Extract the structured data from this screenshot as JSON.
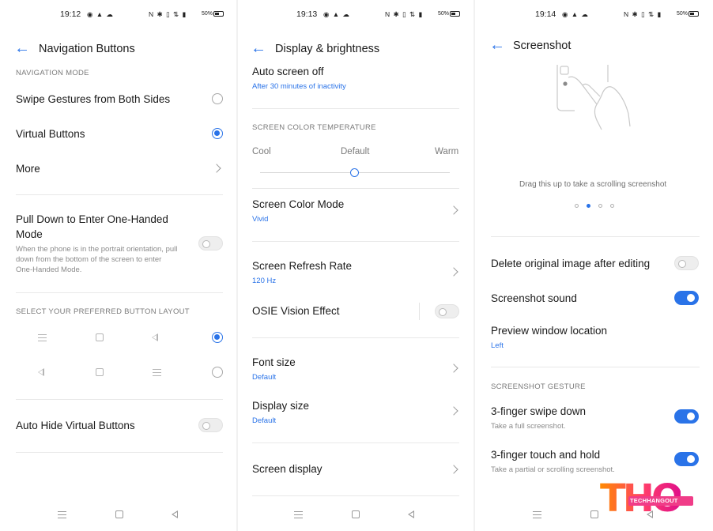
{
  "screen1": {
    "status_time": "19:12",
    "status_icons": "N ✱ ▯ ⇅ ▮",
    "battery": "50%",
    "title": "Navigation Buttons",
    "section_mode": "NAVIGATION MODE",
    "option_swipe": "Swipe Gestures from Both Sides",
    "option_virtual": "Virtual Buttons",
    "more": "More",
    "one_handed_title_l1": "Pull Down to Enter One-Handed",
    "one_handed_title_l2": "Mode",
    "one_handed_desc_l1": "When the phone is in the portrait orientation, pull",
    "one_handed_desc_l2": "down from the bottom of the screen to enter",
    "one_handed_desc_l3": "One-Handed Mode.",
    "section_layout": "SELECT YOUR PREFERRED BUTTON LAYOUT",
    "auto_hide": "Auto Hide Virtual Buttons",
    "selected_mode": "Virtual Buttons",
    "selected_layout": "layout-1",
    "one_handed_enabled": false,
    "auto_hide_enabled": false
  },
  "screen2": {
    "status_time": "19:13",
    "status_icons": "N ✱ ▯ ⇅ ▮",
    "battery": "50%",
    "title": "Display & brightness",
    "auto_off_title": "Auto screen off",
    "auto_off_value": "After 30 minutes of inactivity",
    "section_temp": "SCREEN COLOR TEMPERATURE",
    "temp_cool": "Cool",
    "temp_default": "Default",
    "temp_warm": "Warm",
    "temp_level": 0.5,
    "color_mode_title": "Screen Color Mode",
    "color_mode_value": "Vivid",
    "refresh_title": "Screen Refresh Rate",
    "refresh_value": "120 Hz",
    "osie_title": "OSIE Vision Effect",
    "osie_enabled": false,
    "font_title": "Font size",
    "font_value": "Default",
    "display_size_title": "Display size",
    "display_size_value": "Default",
    "screen_display": "Screen display"
  },
  "screen3": {
    "status_time": "19:14",
    "status_icons": "N ✱ ▯ ⇅ ▮",
    "battery": "50%",
    "title": "Screenshot",
    "drag_hint": "Drag this up to take a scrolling screenshot",
    "page_indicator": {
      "count": 4,
      "active": 2
    },
    "delete_original": "Delete original image after editing",
    "delete_original_enabled": false,
    "sound": "Screenshot sound",
    "sound_enabled": true,
    "preview_title": "Preview window location",
    "preview_value": "Left",
    "section_gesture": "SCREENSHOT GESTURE",
    "swipe_title": "3-finger swipe down",
    "swipe_desc": "Take a full screenshot.",
    "swipe_enabled": true,
    "touch_title": "3-finger touch and hold",
    "touch_desc": "Take a partial or scrolling screenshot.",
    "touch_enabled": true
  },
  "watermark": {
    "letters": "THO",
    "text": "TECHHANGOUT"
  },
  "colors": {
    "accent": "#2a73e8",
    "secondary_text": "#8a8a8a",
    "divider": "#e8e8e8"
  }
}
